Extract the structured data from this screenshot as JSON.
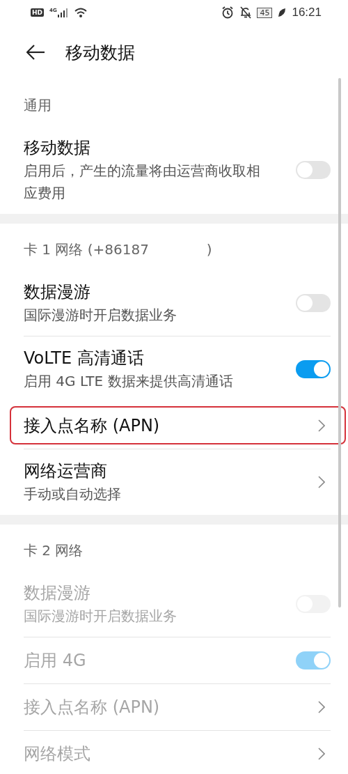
{
  "status_bar": {
    "hd": "HD",
    "network": "4G",
    "battery": "45",
    "time": "16:21"
  },
  "header": {
    "title": "移动数据"
  },
  "sections": [
    {
      "label": "通用",
      "items": [
        {
          "kind": "toggle",
          "title": "移动数据",
          "subtitle": "启用后，产生的流量将由运营商收取相应费用",
          "on": false,
          "disabled": false
        }
      ]
    },
    {
      "label": "卡 1 网络 (+86187             )",
      "items": [
        {
          "kind": "toggle",
          "title": "数据漫游",
          "subtitle": "国际漫游时开启数据业务",
          "on": false,
          "disabled": false
        },
        {
          "kind": "toggle",
          "title": "VoLTE 高清通话",
          "subtitle": "启用 4G LTE 数据来提供高清通话",
          "on": true,
          "disabled": false
        },
        {
          "kind": "link",
          "title": "接入点名称 (APN)",
          "disabled": false,
          "highlighted": true
        },
        {
          "kind": "link",
          "title": "网络运营商",
          "subtitle": "手动或自动选择",
          "disabled": false,
          "highlighted": false
        }
      ]
    },
    {
      "label": "卡 2 网络",
      "items": [
        {
          "kind": "toggle",
          "title": "数据漫游",
          "subtitle": "国际漫游时开启数据业务",
          "on": false,
          "disabled": true
        },
        {
          "kind": "toggle",
          "title": "启用 4G",
          "on": true,
          "disabled": true
        },
        {
          "kind": "link",
          "title": "接入点名称 (APN)",
          "disabled": true,
          "highlighted": false
        },
        {
          "kind": "link",
          "title": "网络模式",
          "disabled": true,
          "highlighted": false
        }
      ]
    }
  ]
}
